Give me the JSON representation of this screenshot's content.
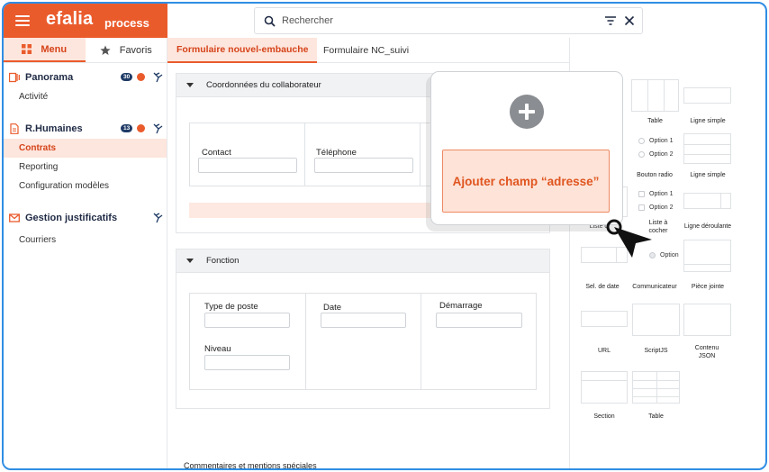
{
  "header": {
    "logo": "efalia",
    "logo_sub": "process",
    "search_placeholder": "Rechercher"
  },
  "sidebar": {
    "tabs": [
      {
        "label": "Menu",
        "active": true
      },
      {
        "label": "Favoris",
        "active": false
      }
    ],
    "sections": [
      {
        "title": "Panorama",
        "badge": "30",
        "items": [
          "Activité"
        ]
      },
      {
        "title": "R.Humaines",
        "badge": "13",
        "items": [
          "Contrats",
          "Reporting",
          "Configuration modèles"
        ],
        "active_item": "Contrats"
      },
      {
        "title": "Gestion justificatifs",
        "items": [
          "Courriers"
        ]
      }
    ]
  },
  "page_tabs": [
    "Formulaire nouvel-embauche",
    "Formulaire  NC_suivi"
  ],
  "form": {
    "panel1": {
      "title": "Coordonnées du collaborateur",
      "fields": [
        "Contact",
        "Téléphone"
      ]
    },
    "panel2": {
      "title": "Fonction",
      "fields": [
        "Type de poste",
        "Date",
        "Démarrage",
        "Niveau"
      ]
    },
    "comments_label": "Commentaires et mentions spéciales"
  },
  "palette": {
    "items": [
      "Table",
      "Ligne simple",
      "Bouton radio",
      "Ligne simple",
      "Liste d",
      "Liste à cocher",
      "Ligne déroulante",
      "Sel. de date",
      "Communicateur",
      "Pièce jointe",
      "URL",
      "ScriptJS",
      "Contenu JSON",
      "Section",
      "Table"
    ],
    "option_texts": [
      "Option 1",
      "Option 2",
      "Option 1",
      "Option 2",
      "Option"
    ]
  },
  "popup": {
    "button_label": "Ajouter champ “adresse”"
  },
  "colors": {
    "brand": "#ea5b2c",
    "border": "#2f8de4"
  }
}
